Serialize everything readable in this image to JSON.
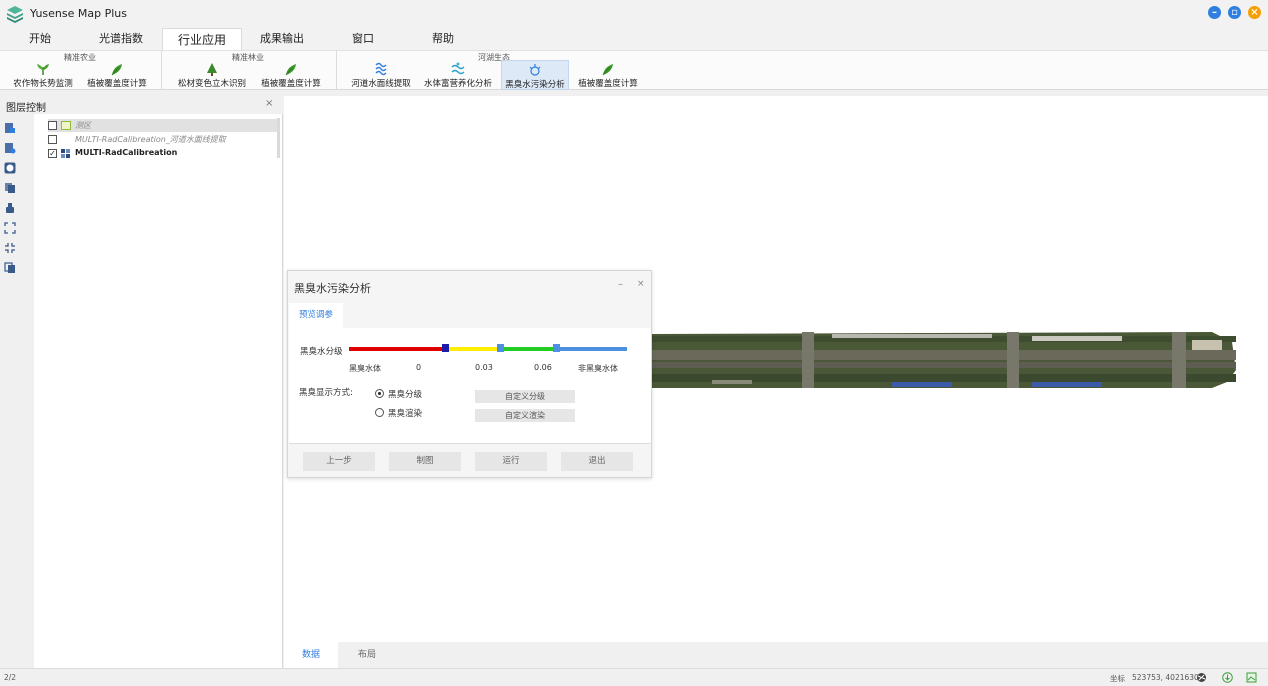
{
  "app": {
    "title": "Yusense Map Plus",
    "logo_icon": "layers-logo-icon",
    "window_controls": [
      "minimize-icon",
      "maximize-icon",
      "close-icon"
    ],
    "window_glyphs": {
      "minimize": "–",
      "maximize": "▫",
      "close": "×"
    }
  },
  "menu": {
    "tabs": [
      {
        "label": "开始"
      },
      {
        "label": "光谱指数"
      },
      {
        "label": "行业应用",
        "active": true
      },
      {
        "label": "成果输出"
      },
      {
        "label": "窗口"
      },
      {
        "label": "帮助"
      }
    ]
  },
  "ribbon": {
    "groups": [
      {
        "title": "精准农业",
        "buttons": [
          {
            "label": "农作物长势监测",
            "icon": "crop-icon"
          },
          {
            "label": "植被覆盖度计算",
            "icon": "leaf-icon"
          }
        ]
      },
      {
        "title": "精准林业",
        "buttons": [
          {
            "label": "松材变色立木识别",
            "icon": "tree-icon"
          },
          {
            "label": "植被覆盖度计算",
            "icon": "leaf-icon"
          }
        ]
      },
      {
        "title": "河湖生态",
        "buttons": [
          {
            "label": "河道水面线提取",
            "icon": "water-line-icon"
          },
          {
            "label": "水体富营养化分析",
            "icon": "water-nutrient-icon"
          },
          {
            "label": "黑臭水污染分析",
            "icon": "pollution-icon",
            "active": true
          },
          {
            "label": "植被覆盖度计算",
            "icon": "leaf-icon"
          }
        ]
      }
    ]
  },
  "layer_panel": {
    "title": "图层控制",
    "close_glyph": "×",
    "tools": [
      "add-layer-icon",
      "add-vector-icon",
      "globe-icon",
      "copy-layer-icon",
      "pan-hand-icon",
      "full-extent-icon",
      "zoom-extent-icon",
      "duplicate-icon"
    ],
    "layers": [
      {
        "name": "测区",
        "checked": false,
        "style": "italic-gray",
        "swatch": "polygon"
      },
      {
        "name": "MULTI-RadCalibreation_河道水面线提取",
        "checked": false,
        "style": "italic-gray",
        "swatch": "none"
      },
      {
        "name": "MULTI-RadCalibreation",
        "checked": true,
        "style": "bold",
        "swatch": "raster"
      }
    ]
  },
  "map": {
    "bottom_tabs": [
      {
        "label": "数据",
        "active": true
      },
      {
        "label": "布局"
      }
    ]
  },
  "dialog": {
    "title": "黑臭水污染分析",
    "min_glyph": "–",
    "close_glyph": "×",
    "tab_label": "预览调参",
    "classification_label": "黑臭水分级",
    "gradient_colors": [
      "#e00000",
      "#ffee00",
      "#22cc22",
      "#4d8fe0"
    ],
    "ticks": [
      "黑臭水体",
      "0",
      "0.03",
      "0.06",
      "非黑臭水体"
    ],
    "display_label": "黑臭显示方式:",
    "options": [
      {
        "label": "黑臭分级",
        "selected": true,
        "button": "自定义分级"
      },
      {
        "label": "黑臭渲染",
        "selected": false,
        "button": "自定义渲染"
      }
    ],
    "footer_buttons": [
      "上一步",
      "制图",
      "运行",
      "退出"
    ]
  },
  "status": {
    "page": "2/2",
    "coord_label": "坐标",
    "coord_value": "523753, 4021630",
    "icons": [
      "globe-status-icon",
      "download-icon",
      "map-status-icon"
    ]
  }
}
